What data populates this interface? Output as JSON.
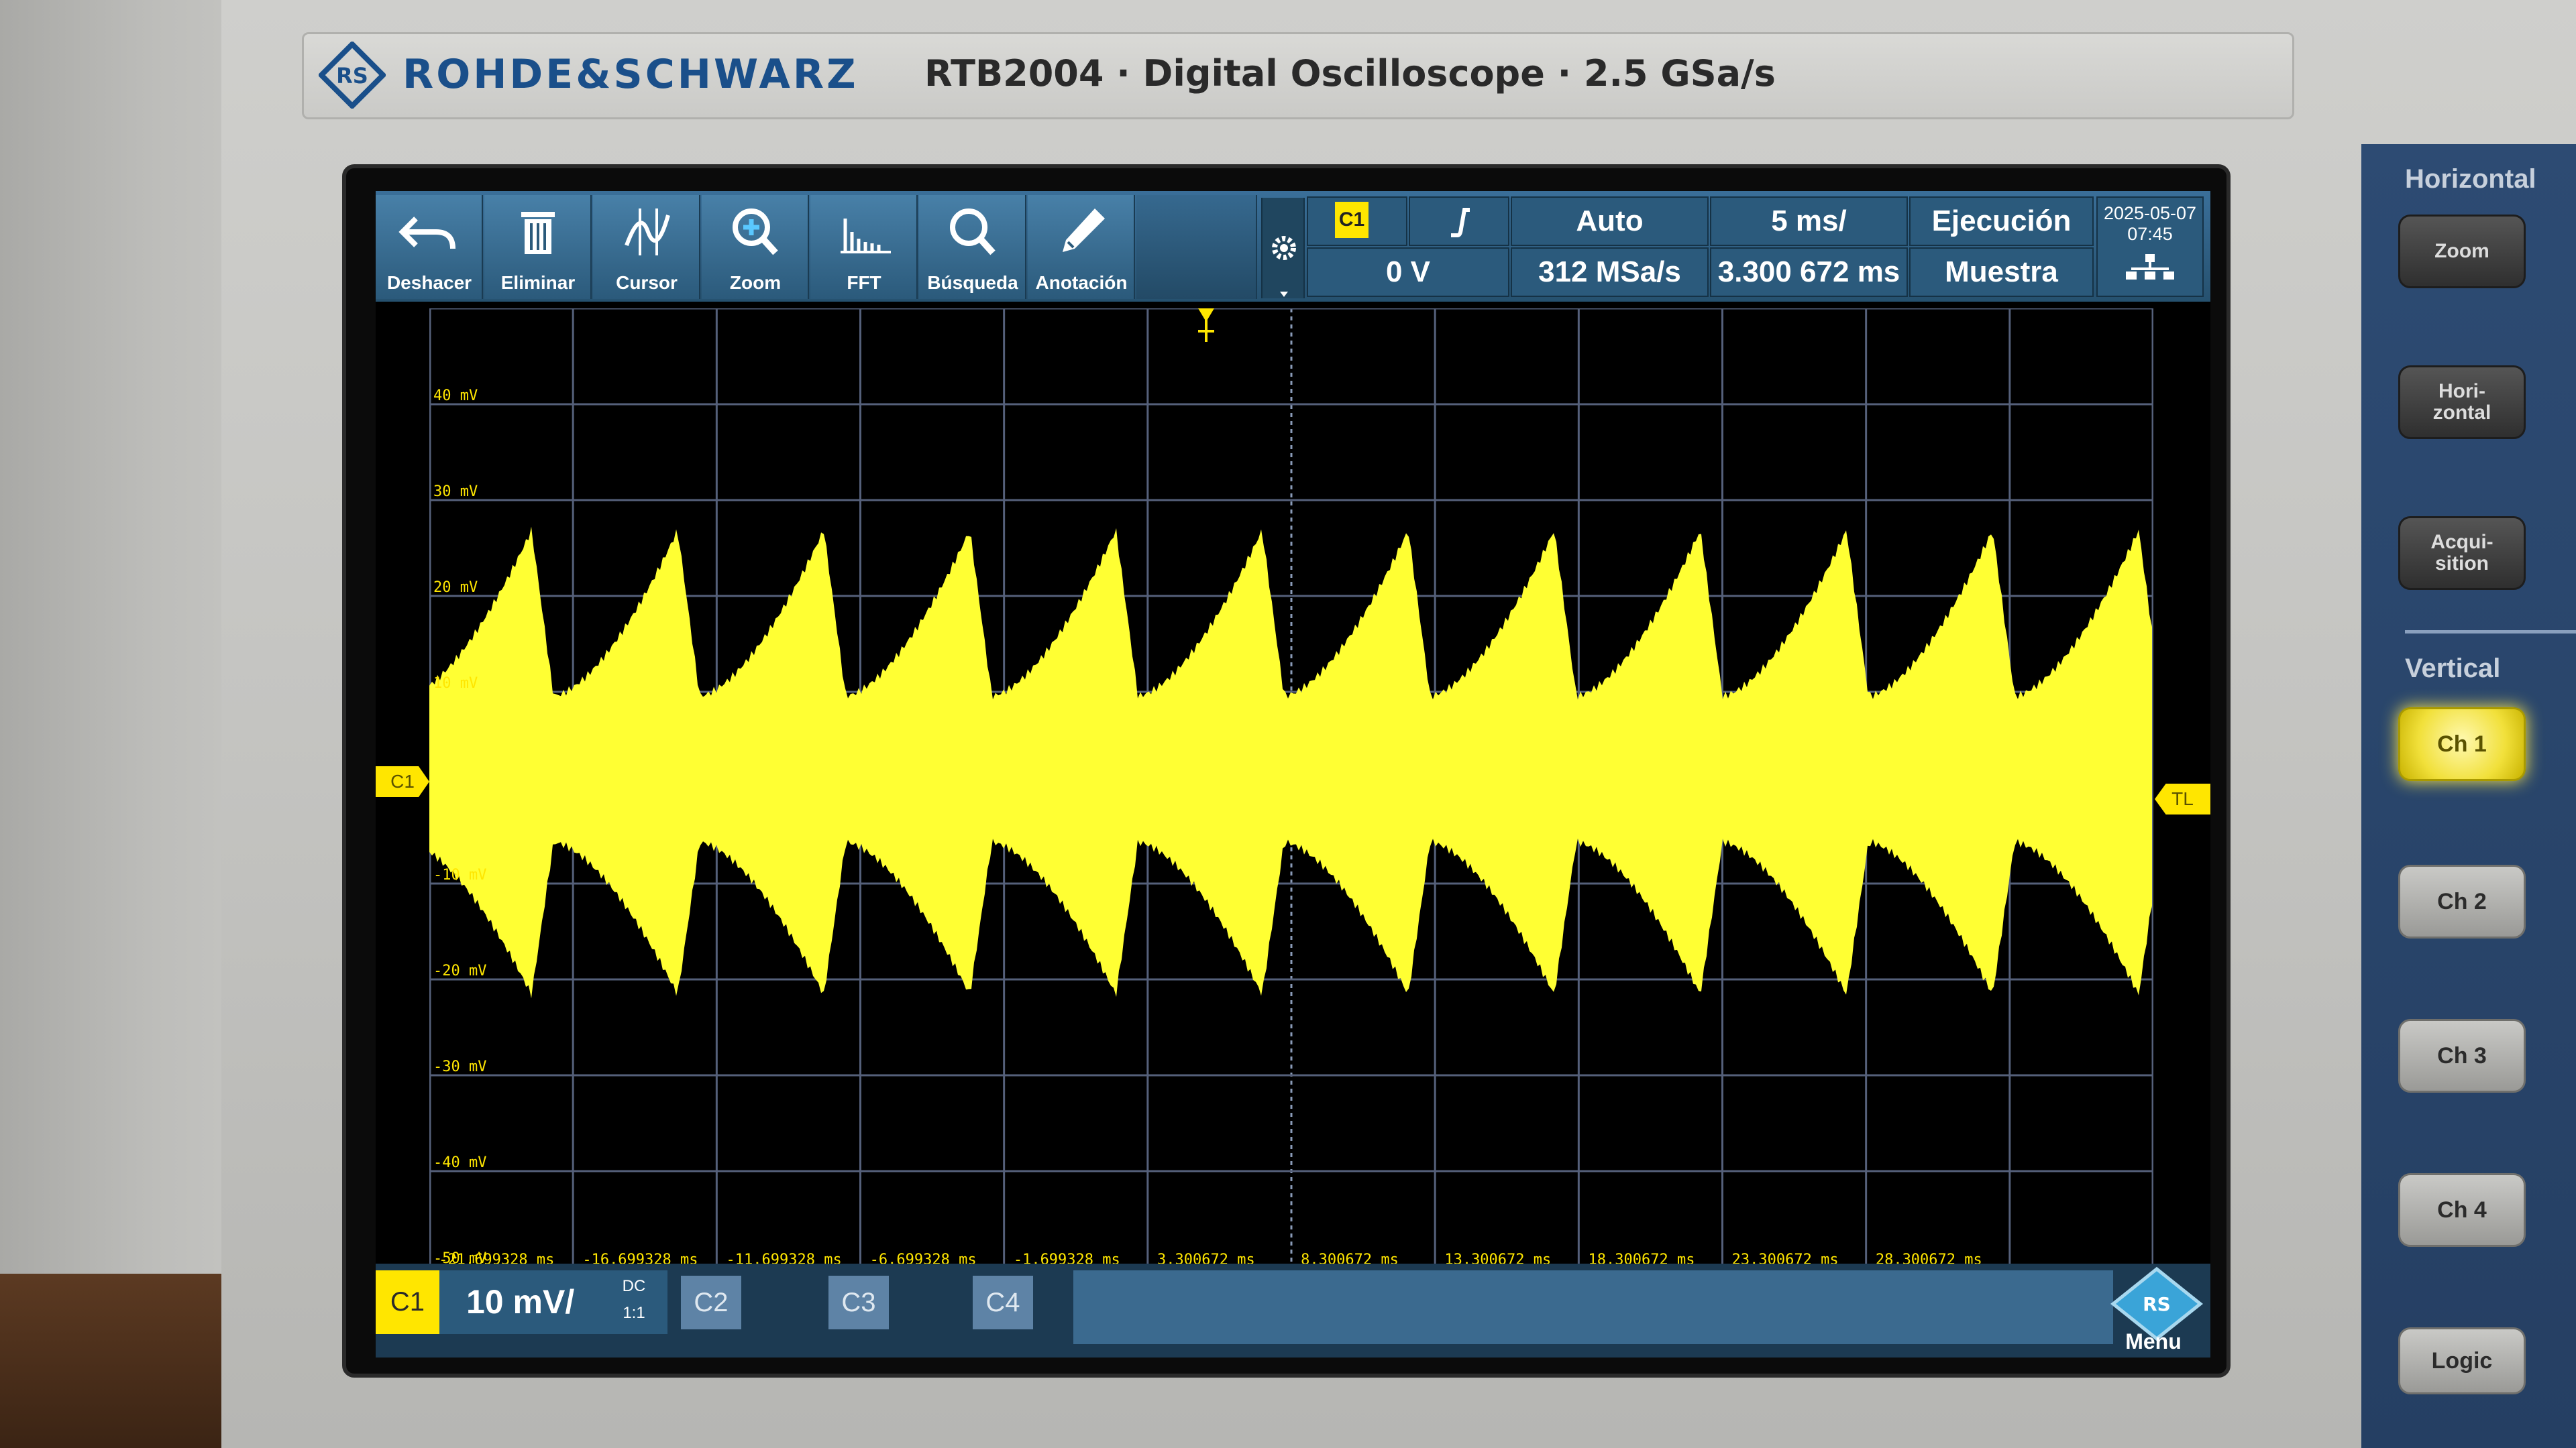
{
  "brand": {
    "name": "ROHDE&SCHWARZ",
    "model": "RTB2004 · Digital Oscilloscope · 2.5 GSa/s"
  },
  "toolbar": [
    {
      "label": "Deshacer",
      "icon": "undo-icon"
    },
    {
      "label": "Eliminar",
      "icon": "trash-icon"
    },
    {
      "label": "Cursor",
      "icon": "cursor-icon"
    },
    {
      "label": "Zoom",
      "icon": "zoom-icon"
    },
    {
      "label": "FFT",
      "icon": "fft-icon"
    },
    {
      "label": "Búsqueda",
      "icon": "search-icon"
    },
    {
      "label": "Anotación",
      "icon": "pencil-icon"
    }
  ],
  "status": {
    "trigger_source": "C1",
    "trigger_level": "0 V",
    "trigger_mode": "Auto",
    "sample_rate": "312 MSa/s",
    "time_scale": "5 ms/",
    "time_offset": "3.300 672 ms",
    "run_state": "Ejecución",
    "acq_mode": "Muestra",
    "date": "2025-05-07",
    "time": "07:45"
  },
  "plot": {
    "y_labels": [
      "40 mV",
      "30 mV",
      "20 mV",
      "10 mV",
      "-10 mV",
      "-20 mV",
      "-30 mV",
      "-40 mV",
      "-50 mV"
    ],
    "x_labels": [
      "-21.699328 ms",
      "-16.699328 ms",
      "-11.699328 ms",
      "-6.699328 ms",
      "-1.699328 ms",
      "3.300672 ms",
      "8.300672 ms",
      "13.300672 ms",
      "18.300672 ms",
      "23.300672 ms",
      "28.300672 ms"
    ],
    "ch_marker": "C1",
    "trigger_marker": "TL",
    "trace_color": "#ffff33"
  },
  "channels": {
    "ch1_label": "C1",
    "ch1_scale": "10 mV/",
    "ch1_coupling": "DC",
    "ch1_probe": "1:1",
    "ch2_label": "C2",
    "ch3_label": "C3",
    "ch4_label": "C4",
    "menu_label": "Menu"
  },
  "panel": {
    "horizontal_head": "Horizontal",
    "zoom": "Zoom",
    "horizontal_btn": "Hori-\nzontal",
    "acquisition_btn": "Acqui-\nsition",
    "vertical_head": "Vertical",
    "ch1": "Ch 1",
    "ch2": "Ch 2",
    "ch3": "Ch 3",
    "ch4": "Ch 4",
    "logic": "Logic"
  }
}
